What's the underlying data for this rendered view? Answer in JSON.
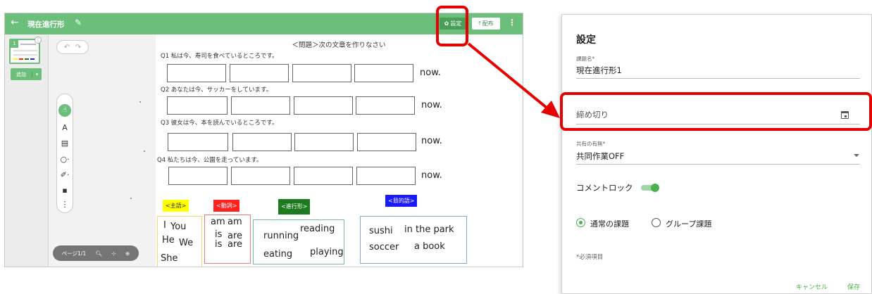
{
  "editor": {
    "title": "現在進行形",
    "settings_label": "設定",
    "distribute_label": "配布",
    "page_thumb_number": "1",
    "add_label": "追加",
    "pager_label": "ページ1/1",
    "collapse_glyph": "«"
  },
  "icons": {
    "back": "←",
    "pencil": "✎",
    "more": "⋮",
    "gear": "✿",
    "upload": "⤒",
    "undo": "↶",
    "redo": "↷",
    "pointer": "☝",
    "text_tool": "A",
    "note_tool": "▤",
    "shape_tool": "○·",
    "pen_tool": "✐·",
    "image_tool": "▪",
    "more_tools": "⋮",
    "zoom_out": "🔍︎",
    "fit": "⊹",
    "zoom_in": "⊕",
    "caret": "▾"
  },
  "worksheet": {
    "heading": "＜問題＞次の文章を作りなさい",
    "questions": [
      "Q1  私は今、寿司を食べているところです。",
      "Q2  あなたは今、サッカーをしています。",
      "Q3  彼女は今、本を読んでいるところです。",
      "Q4 私たちは今、公園を走っています。"
    ],
    "now_word": "now.",
    "tags": {
      "subject": "<主語>",
      "verb": "<動詞>",
      "progressive": "<進行形>",
      "object": "<目的語>"
    },
    "subject_words": [
      "I",
      "You",
      "He",
      "We",
      "She"
    ],
    "verb_words": [
      "am",
      "am",
      "is",
      "are",
      "is",
      "are"
    ],
    "progressive_words": [
      "reading",
      "running",
      "eating",
      "playing"
    ],
    "object_words": [
      "sushi",
      "in the park",
      "soccer",
      "a book"
    ]
  },
  "settings": {
    "title": "設定",
    "task_name_label": "課題名*",
    "task_name_value": "現在進行形1",
    "deadline_placeholder": "締め切り",
    "share_label": "共有の有無*",
    "share_value": "共同作業OFF",
    "comment_lock_label": "コメントロック",
    "comment_lock_on": true,
    "task_type_normal": "通常の課題",
    "task_type_group": "グループ課題",
    "selected_task_type": "通常の課題",
    "required_note": "*必須項目",
    "cancel_label": "キャンセル",
    "save_label": "保存"
  },
  "colors": {
    "brand_green": "#6bbf7a",
    "highlight_red": "#e60000",
    "tag_subject": "#ffff00",
    "tag_verb": "#ff2020",
    "tag_progressive": "#1e7a1e",
    "tag_object": "#1a1aff"
  }
}
